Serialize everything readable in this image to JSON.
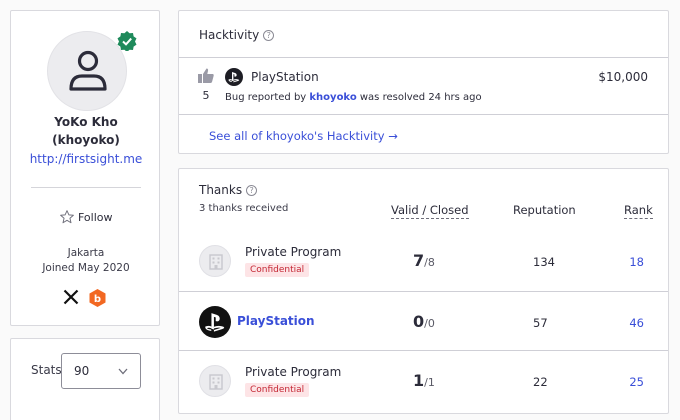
{
  "profile": {
    "name": "YoKo Kho",
    "username": "(khoyoko)",
    "website": "http://firstsight.me",
    "follow_label": "Follow",
    "location": "Jakarta",
    "joined": "Joined May 2020",
    "social": [
      "x-icon",
      "bugcrowd-icon"
    ]
  },
  "stats": {
    "label": "Stats",
    "selected": "90"
  },
  "hacktivity": {
    "title": "Hacktivity",
    "report": {
      "votes": "5",
      "program": "PlayStation",
      "bounty": "$10,000",
      "desc_prefix": "Bug reported by",
      "reporter": "khoyoko",
      "desc_suffix": "was resolved 24 hrs ago"
    },
    "see_all": "See all of khoyoko's Hacktivity →"
  },
  "thanks": {
    "title": "Thanks",
    "subtitle": "3 thanks received",
    "columns": {
      "valid": "Valid / Closed",
      "reputation": "Reputation",
      "rank": "Rank"
    },
    "rows": [
      {
        "name": "Private Program",
        "badge": "Confidential",
        "valid": "7",
        "closed": "/8",
        "reputation": "134",
        "rank": "18"
      },
      {
        "name": "PlayStation",
        "valid": "0",
        "closed": "/0",
        "reputation": "57",
        "rank": "46"
      },
      {
        "name": "Private Program",
        "badge": "Confidential",
        "valid": "1",
        "closed": "/1",
        "reputation": "22",
        "rank": "25"
      }
    ]
  },
  "colors": {
    "link": "#3a4fd8",
    "verified": "#1f8a5b",
    "confidential_text": "#c42734",
    "confidential_bg": "#fde4e6"
  }
}
